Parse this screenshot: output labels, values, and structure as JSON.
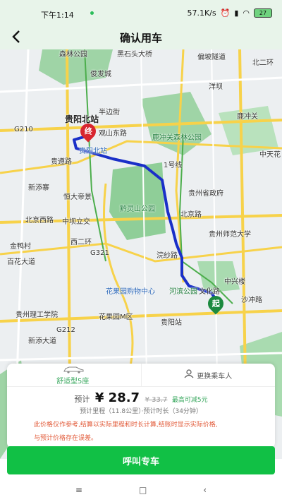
{
  "status_bar": {
    "time": "下午1:14",
    "net_speed": "57.1K/s",
    "battery": "27"
  },
  "header": {
    "back_icon": "chevron-left-icon",
    "title": "确认用车"
  },
  "map": {
    "labels": [
      "森林公园",
      "黑石头大桥",
      "偏坡隧道",
      "北二环",
      "俊发城",
      "洋坝",
      "贵阳北站",
      "半边街",
      "鹿冲关",
      "G210",
      "观山东路",
      "鹿冲关森林公园",
      "中天花",
      "贵阳北站",
      "1号线",
      "贵遵路",
      "新添寨",
      "恒大帝景",
      "贵州省政府",
      "黔灵山公园",
      "北京西路",
      "中坝立交",
      "北京路",
      "贵州师范大学",
      "金鸭村",
      "西二环",
      "G321",
      "浣纱路",
      "百花大道",
      "中兴楼",
      "花果园购物中心",
      "河滨公园",
      "文化路",
      "沙冲路",
      "贵州理工学院",
      "花果园M区",
      "贵阳站",
      "新添大道",
      "G212"
    ],
    "end_marker": "终",
    "start_marker": "起",
    "route_color": "#1a2fc8"
  },
  "ride_card": {
    "tabs": [
      {
        "label": "舒适型5座",
        "icon": "car-icon"
      },
      {
        "label": "更换乘车人",
        "icon": "person-icon"
      }
    ],
    "estimate_prefix": "预计",
    "currency": "¥",
    "price": "28.7",
    "original_price": "¥ 33.7",
    "discount_text": "最高可减5元",
    "distance_text": "预计里程（11.8公里）·预计时长（34分钟）",
    "notice_lines": [
      "此价格仅作参考,结算以实际里程和时长计算,结账时显示实际价格,",
      "与预计价格存在误差。"
    ]
  },
  "call_button": "呼叫专车",
  "nav_bar": [
    "≡",
    "□",
    "‹"
  ]
}
